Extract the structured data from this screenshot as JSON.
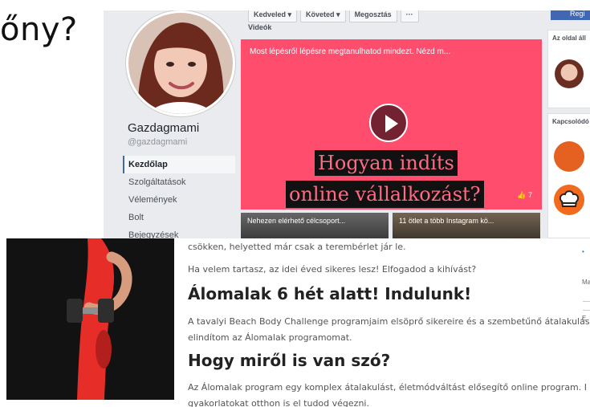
{
  "slide": {
    "title_fragment": "őny?"
  },
  "facebook": {
    "actions": {
      "like": "Kedveled ▾",
      "follow": "Követed ▾",
      "share": "Megosztás",
      "more": "···"
    },
    "register_button": "Regi",
    "sidebar": {
      "page_name": "Gazdagmami",
      "handle": "@gazdagmami",
      "nav": [
        "Kezdőlap",
        "Szolgáltatások",
        "Vélemények",
        "Bolt",
        "Bejegyzések"
      ],
      "active_index": 0
    },
    "videos_label": "Videók",
    "video": {
      "caption": "Most lépésről lépésre megtanulhatod mindezt. Nézd m...",
      "line1": "Hogyan indíts",
      "line2": "online vállalkozást?",
      "likes": "👍 7"
    },
    "thumbnails": [
      "Nehezen elérhető célcsoport...",
      "11 ötlet a több Instagram kö..."
    ],
    "right": {
      "card1_head": "Az oldal áll",
      "card2_head": "Kapcsolódó"
    },
    "colors": {
      "video_bg": "#ff4d6d",
      "banner_text": "#ff6a85",
      "fb_blue": "#4267b2"
    }
  },
  "site": {
    "lines": [
      "csökken, helyetted már csak a terembérlet jár le.",
      "Ha velem tartasz, az idei éved sikeres lesz! Elfogadod a kihívást?",
      "Álomalak 6 hét alatt! Indulunk!",
      "A tavalyi Beach Body Challenge programjaim elsöprő sikereire és a szembetűnő átalakulás",
      "elindítom az Álomalak programomat.",
      "Hogy miről is van szó?",
      "Az Álomalak program egy komplex átalakulást, életmódváltást elősegítő online program. I",
      "gyakorlatokat otthon is el tudod végezni."
    ],
    "edge_marks": {
      "blue_dot": "•",
      "small_m": "Ma",
      "small_e": "E"
    }
  }
}
